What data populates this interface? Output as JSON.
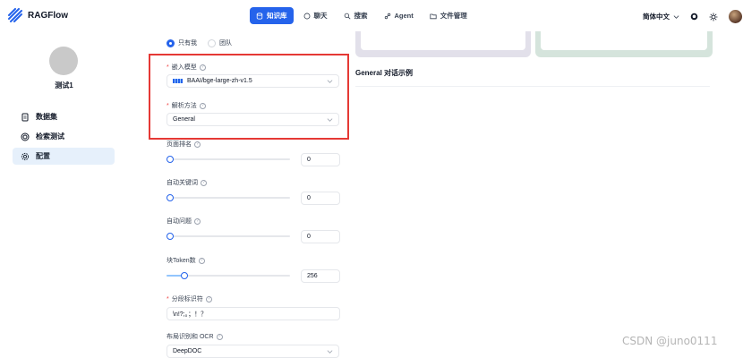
{
  "app": {
    "name": "RAGFlow"
  },
  "nav": [
    {
      "label": "知识库",
      "icon": "database-icon",
      "active": true
    },
    {
      "label": "聊天",
      "icon": "chat-icon",
      "active": false
    },
    {
      "label": "搜索",
      "icon": "search-icon",
      "active": false
    },
    {
      "label": "Agent",
      "icon": "agent-icon",
      "active": false
    },
    {
      "label": "文件管理",
      "icon": "folder-icon",
      "active": false
    }
  ],
  "header": {
    "language": "简体中文"
  },
  "sidebar": {
    "kb_name": "测试1",
    "items": [
      {
        "label": "数据集",
        "icon": "document-icon"
      },
      {
        "label": "检索测试",
        "icon": "target-icon"
      },
      {
        "label": "配置",
        "icon": "gear-icon"
      }
    ]
  },
  "permissions": {
    "option_me": "只有我",
    "option_team": "团队",
    "selected": "只有我"
  },
  "form": {
    "embedding_model": {
      "label": "嵌入模型",
      "value": "BAAI/bge-large-zh-v1.5"
    },
    "parse_method": {
      "label": "解析方法",
      "value": "General"
    },
    "page_rank": {
      "label": "页面排名",
      "value": "0",
      "fraction": 0
    },
    "auto_keywords": {
      "label": "自动关键词",
      "value": "0",
      "fraction": 0
    },
    "auto_questions": {
      "label": "自动问题",
      "value": "0",
      "fraction": 0
    },
    "chunk_tokens": {
      "label": "块Token数",
      "value": "256",
      "fraction": 0.125
    },
    "delimiter": {
      "label": "分段标识符",
      "value": "\\n!?;。；！？"
    },
    "layout_ocr": {
      "label": "布局识别和 OCR",
      "value": "DeepDOC"
    }
  },
  "right_panel": {
    "title": "General 对话示例"
  },
  "watermark": "CSDN @juno0111",
  "colors": {
    "accent": "#2563eb",
    "highlight": "#e53935"
  }
}
